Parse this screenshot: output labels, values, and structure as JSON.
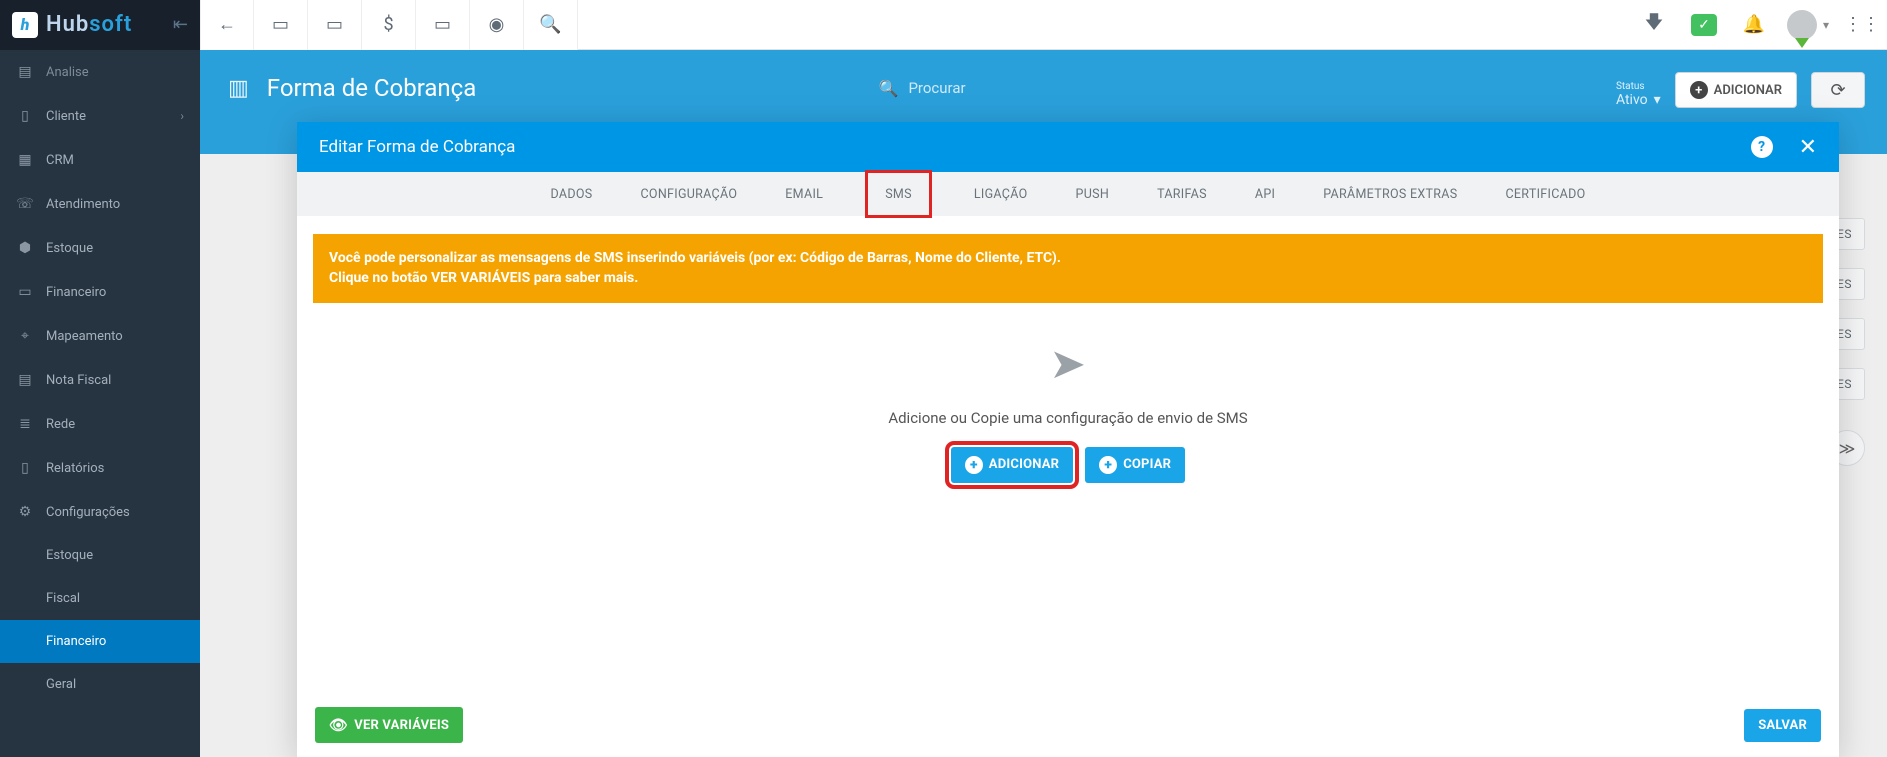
{
  "brand": {
    "hub": "Hub",
    "soft": "soft"
  },
  "sidebar": {
    "items": [
      {
        "label": "Analise"
      },
      {
        "label": "Cliente"
      },
      {
        "label": "CRM"
      },
      {
        "label": "Atendimento"
      },
      {
        "label": "Estoque"
      },
      {
        "label": "Financeiro"
      },
      {
        "label": "Mapeamento"
      },
      {
        "label": "Nota Fiscal"
      },
      {
        "label": "Rede"
      },
      {
        "label": "Relatórios"
      },
      {
        "label": "Configurações"
      }
    ],
    "subs": [
      {
        "label": "Estoque"
      },
      {
        "label": "Fiscal"
      },
      {
        "label": "Financeiro"
      },
      {
        "label": "Geral"
      }
    ]
  },
  "page": {
    "title": "Forma de Cobrança",
    "search_placeholder": "Procurar",
    "status_label": "Status",
    "status_value": "Ativo",
    "add_label": "ADICIONAR",
    "bg_action": "AÇÕES"
  },
  "modal": {
    "title": "Editar Forma de Cobrança",
    "tabs": [
      "DADOS",
      "CONFIGURAÇÃO",
      "EMAIL",
      "SMS",
      "LIGAÇÃO",
      "PUSH",
      "TARIFAS",
      "API",
      "PARÂMETROS EXTRAS",
      "CERTIFICADO"
    ],
    "active_tab_index": 3,
    "banner_line1": "Você pode personalizar as mensagens de SMS inserindo variáveis (por ex: Código de Barras, Nome do Cliente, ETC).",
    "banner_line2": "Clique no botão VER VARIÁVEIS para saber mais.",
    "empty_text": "Adicione ou Copie uma configuração de envio de SMS",
    "btn_add": "ADICIONAR",
    "btn_copy": "COPIAR",
    "btn_vars": "VER VARIÁVEIS",
    "btn_save": "SALVAR"
  }
}
